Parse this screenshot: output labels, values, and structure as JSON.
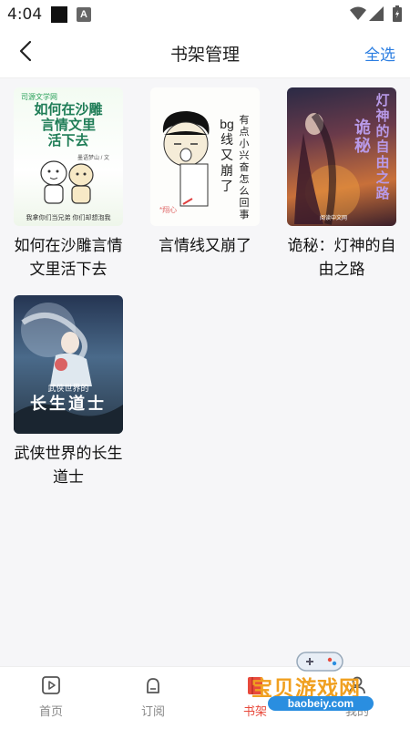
{
  "status_bar": {
    "time": "4:04",
    "icons": [
      "app-icon",
      "a-icon",
      "wifi-icon",
      "signal-icon",
      "battery-icon"
    ]
  },
  "header": {
    "title": "书架管理",
    "select_all_label": "全选",
    "back_icon": "chevron-left-icon"
  },
  "books": [
    {
      "title": "如何在沙雕言情文里活下去",
      "cover": {
        "brand": "司源文学网",
        "lines": [
          "如何在沙雕",
          "言情文里",
          "活下去"
        ],
        "author": "墨语梦山 / 文",
        "footer": "我拿你们当兄弟 你们却想泡我"
      }
    },
    {
      "title": "言情线又崩了",
      "cover": {
        "vertical_main": "bg线又崩了",
        "vertical_side": "有点小兴奋怎么回事",
        "signature": "*翔心"
      }
    },
    {
      "title": "诡秘：灯神的自由之路",
      "cover": {
        "title_a": "诡秘",
        "title_b": "灯神的自由之路",
        "footer": "阅读中文网"
      }
    },
    {
      "title": "武侠世界的长生道士",
      "cover": {
        "subtitle": "武侠世界的",
        "main": "长生道士"
      }
    }
  ],
  "bottom_nav": [
    {
      "label": "首页",
      "icon": "play-square-icon",
      "active": false
    },
    {
      "label": "订阅",
      "icon": "bell-icon",
      "active": false
    },
    {
      "label": "书架",
      "icon": "book-icon",
      "active": true
    },
    {
      "label": "我的",
      "icon": "person-icon",
      "active": false
    }
  ],
  "watermark": {
    "title": "宝贝游戏网",
    "url": "baobeiy.com"
  },
  "colors": {
    "accent": "#2a7de1",
    "active_tab": "#e84a3c",
    "background": "#f6f6f8"
  }
}
